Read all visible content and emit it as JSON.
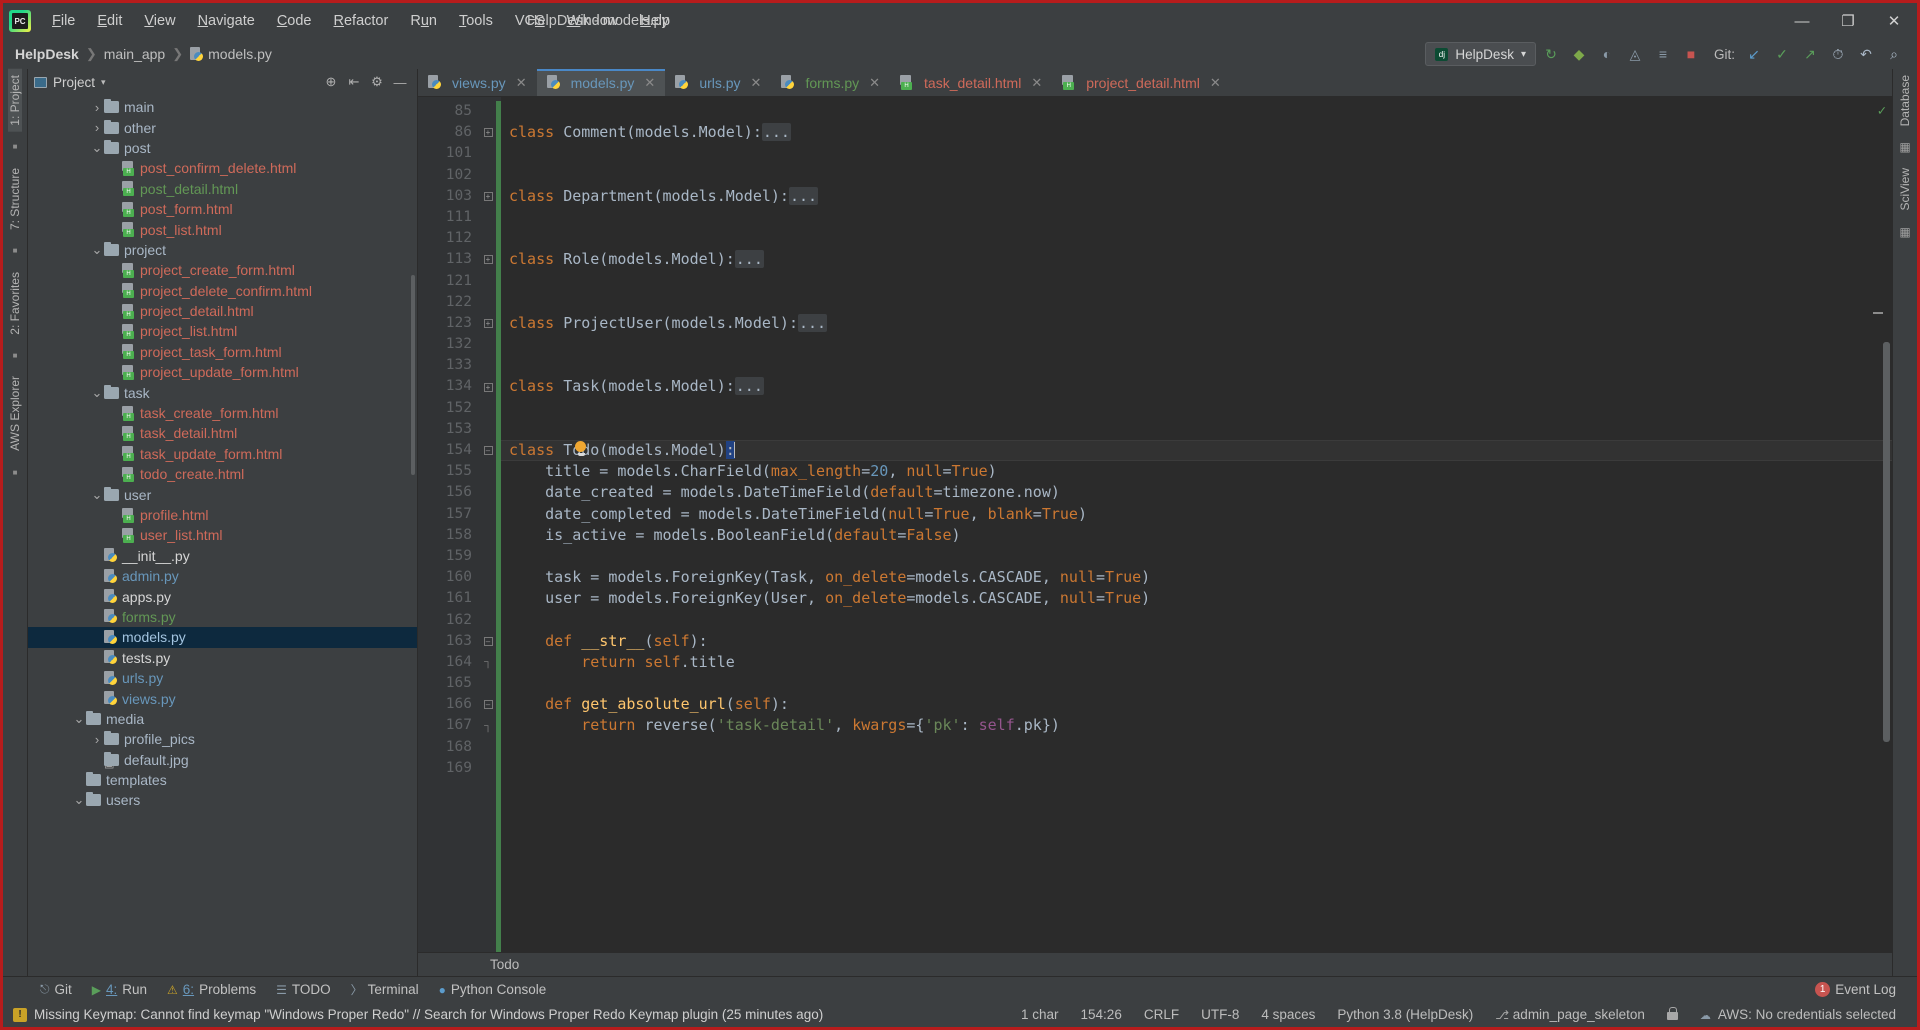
{
  "app": {
    "logo": "pycharm-logo",
    "window_title": "HelpDesk - models.py"
  },
  "menubar": {
    "items": [
      {
        "label": "File",
        "mn": "F"
      },
      {
        "label": "Edit",
        "mn": "E"
      },
      {
        "label": "View",
        "mn": "V"
      },
      {
        "label": "Navigate",
        "mn": "N"
      },
      {
        "label": "Code",
        "mn": "C"
      },
      {
        "label": "Refactor",
        "mn": "R"
      },
      {
        "label": "Run",
        "mn": "u"
      },
      {
        "label": "Tools",
        "mn": "T"
      },
      {
        "label": "VCS",
        "mn": "S"
      },
      {
        "label": "Window",
        "mn": "W"
      },
      {
        "label": "Help",
        "mn": "H"
      }
    ]
  },
  "window_controls": {
    "minimize": "—",
    "maximize": "❐",
    "close": "✕"
  },
  "breadcrumb": {
    "project": "HelpDesk",
    "app": "main_app",
    "file": "models.py",
    "sep": "❯"
  },
  "navbar_right": {
    "run_config": "HelpDesk",
    "run_config_caret": "▾",
    "icons": [
      {
        "name": "build-icon",
        "glyph": "↻"
      },
      {
        "name": "debug-icon",
        "glyph": "ὁe"
      },
      {
        "name": "coverage-icon",
        "glyph": "◔"
      },
      {
        "name": "profile-icon",
        "glyph": "◴"
      },
      {
        "name": "run-with-console-icon",
        "glyph": "≡"
      },
      {
        "name": "stop-icon",
        "glyph": "■"
      }
    ],
    "git_label": "Git:",
    "git_icons": [
      {
        "name": "git-update-icon",
        "glyph": "↙"
      },
      {
        "name": "git-commit-icon",
        "glyph": "✓"
      },
      {
        "name": "git-push-icon",
        "glyph": "↗"
      },
      {
        "name": "git-history-icon",
        "glyph": "◴"
      },
      {
        "name": "git-rollback-icon",
        "glyph": "↶"
      }
    ],
    "search_icon": "⌕"
  },
  "left_rail": {
    "items": [
      {
        "label": "1: Project",
        "active": true
      },
      {
        "label": "7: Structure",
        "active": false
      },
      {
        "label": "2: Favorites",
        "active": false
      },
      {
        "label": "AWS Explorer",
        "active": false
      }
    ],
    "bottom_icon": "aws-icon"
  },
  "right_rail": {
    "items": [
      {
        "label": "Database",
        "active": false
      },
      {
        "label": "SciView",
        "active": false
      }
    ]
  },
  "project_panel": {
    "title": "Project",
    "title_caret": "▾",
    "header_icons": [
      {
        "name": "target-icon",
        "glyph": "⊕"
      },
      {
        "name": "collapse-all-icon",
        "glyph": "⇥"
      },
      {
        "name": "settings-gear-icon",
        "glyph": "⚙"
      },
      {
        "name": "hide-panel-icon",
        "glyph": "—"
      }
    ],
    "tree": [
      {
        "label": "main",
        "type": "folder",
        "indent": 2,
        "arrow": "›",
        "color": "#a9b7c6"
      },
      {
        "label": "other",
        "type": "folder",
        "indent": 2,
        "arrow": "›",
        "color": "#a9b7c6"
      },
      {
        "label": "post",
        "type": "folder",
        "indent": 2,
        "arrow": "⌄",
        "color": "#a9b7c6"
      },
      {
        "label": "post_confirm_delete.html",
        "type": "html",
        "indent": 3,
        "color": "#cf6a5a"
      },
      {
        "label": "post_detail.html",
        "type": "html",
        "indent": 3,
        "color": "#629755"
      },
      {
        "label": "post_form.html",
        "type": "html",
        "indent": 3,
        "color": "#cf6a5a"
      },
      {
        "label": "post_list.html",
        "type": "html",
        "indent": 3,
        "color": "#cf6a5a"
      },
      {
        "label": "project",
        "type": "folder",
        "indent": 2,
        "arrow": "⌄",
        "color": "#a9b7c6"
      },
      {
        "label": "project_create_form.html",
        "type": "html",
        "indent": 3,
        "color": "#cf6a5a"
      },
      {
        "label": "project_delete_confirm.html",
        "type": "html",
        "indent": 3,
        "color": "#cf6a5a"
      },
      {
        "label": "project_detail.html",
        "type": "html",
        "indent": 3,
        "color": "#cf6a5a"
      },
      {
        "label": "project_list.html",
        "type": "html",
        "indent": 3,
        "color": "#cf6a5a"
      },
      {
        "label": "project_task_form.html",
        "type": "html",
        "indent": 3,
        "color": "#cf6a5a"
      },
      {
        "label": "project_update_form.html",
        "type": "html",
        "indent": 3,
        "color": "#cf6a5a"
      },
      {
        "label": "task",
        "type": "folder",
        "indent": 2,
        "arrow": "⌄",
        "color": "#a9b7c6"
      },
      {
        "label": "task_create_form.html",
        "type": "html",
        "indent": 3,
        "color": "#cf6a5a"
      },
      {
        "label": "task_detail.html",
        "type": "html",
        "indent": 3,
        "color": "#cf6a5a"
      },
      {
        "label": "task_update_form.html",
        "type": "html",
        "indent": 3,
        "color": "#cf6a5a"
      },
      {
        "label": "todo_create.html",
        "type": "html",
        "indent": 3,
        "color": "#cf6a5a"
      },
      {
        "label": "user",
        "type": "folder",
        "indent": 2,
        "arrow": "⌄",
        "color": "#a9b7c6"
      },
      {
        "label": "profile.html",
        "type": "html",
        "indent": 3,
        "color": "#cf6a5a"
      },
      {
        "label": "user_list.html",
        "type": "html",
        "indent": 3,
        "color": "#cf6a5a"
      },
      {
        "label": "__init__.py",
        "type": "py",
        "indent": 2,
        "color": "#d6d6d6"
      },
      {
        "label": "admin.py",
        "type": "py",
        "indent": 2,
        "color": "#6897bb"
      },
      {
        "label": "apps.py",
        "type": "py",
        "indent": 2,
        "color": "#d6d6d6"
      },
      {
        "label": "forms.py",
        "type": "py",
        "indent": 2,
        "color": "#629755"
      },
      {
        "label": "models.py",
        "type": "py",
        "indent": 2,
        "color": "#a3c4e0",
        "selected": true
      },
      {
        "label": "tests.py",
        "type": "py",
        "indent": 2,
        "color": "#d6d6d6"
      },
      {
        "label": "urls.py",
        "type": "py",
        "indent": 2,
        "color": "#6897bb"
      },
      {
        "label": "views.py",
        "type": "py",
        "indent": 2,
        "color": "#6897bb"
      },
      {
        "label": "media",
        "type": "folder",
        "indent": 1,
        "arrow": "⌄",
        "color": "#a9b7c6"
      },
      {
        "label": "profile_pics",
        "type": "folder",
        "indent": 2,
        "arrow": "›",
        "color": "#a9b7c6"
      },
      {
        "label": "default.jpg",
        "type": "img",
        "indent": 2,
        "color": "#a9b7c6"
      },
      {
        "label": "templates",
        "type": "folder",
        "indent": 1,
        "arrow": "",
        "color": "#a9b7c6"
      },
      {
        "label": "users",
        "type": "folder",
        "indent": 1,
        "arrow": "⌄",
        "color": "#a9b7c6"
      }
    ]
  },
  "editor_tabs": [
    {
      "label": "views.py",
      "type": "py",
      "color": "#6897bb",
      "active": false,
      "close": "✕"
    },
    {
      "label": "models.py",
      "type": "py",
      "color": "#6897bb",
      "active": true,
      "close": "✕"
    },
    {
      "label": "urls.py",
      "type": "py",
      "color": "#6897bb",
      "active": false,
      "close": "✕"
    },
    {
      "label": "forms.py",
      "type": "py",
      "color": "#629755",
      "active": false,
      "close": "✕"
    },
    {
      "label": "task_detail.html",
      "type": "html",
      "color": "#cf6a5a",
      "active": false,
      "close": "✕"
    },
    {
      "label": "project_detail.html",
      "type": "html",
      "color": "#cf6a5a",
      "active": false,
      "close": "✕"
    }
  ],
  "editor": {
    "line_numbers": [
      "85",
      "86",
      "101",
      "102",
      "103",
      "111",
      "112",
      "113",
      "121",
      "122",
      "123",
      "132",
      "133",
      "134",
      "152",
      "153",
      "154",
      "155",
      "156",
      "157",
      "158",
      "159",
      "160",
      "161",
      "162",
      "163",
      "164",
      "165",
      "166",
      "167",
      "168",
      "169"
    ],
    "status_breadcrumb": "Todo",
    "caret_position": "154:26",
    "lightbulb": "intention-bulb-icon",
    "inspection_ok": "✓"
  },
  "code_lines": [
    {
      "num": "85",
      "fold": "",
      "segs": []
    },
    {
      "num": "86",
      "fold": "+",
      "segs": [
        {
          "t": "class ",
          "c": "kw"
        },
        {
          "t": "Comment(models.Model):",
          "c": "cls"
        },
        {
          "t": "...",
          "c": "fold3"
        }
      ]
    },
    {
      "num": "101",
      "fold": "",
      "segs": []
    },
    {
      "num": "102",
      "fold": "",
      "segs": []
    },
    {
      "num": "103",
      "fold": "+",
      "segs": [
        {
          "t": "class ",
          "c": "kw"
        },
        {
          "t": "Department(models.Model):",
          "c": "cls"
        },
        {
          "t": "...",
          "c": "fold3"
        }
      ]
    },
    {
      "num": "111",
      "fold": "",
      "segs": []
    },
    {
      "num": "112",
      "fold": "",
      "segs": []
    },
    {
      "num": "113",
      "fold": "+",
      "segs": [
        {
          "t": "class ",
          "c": "kw"
        },
        {
          "t": "Role(models.Model):",
          "c": "cls"
        },
        {
          "t": "...",
          "c": "fold3"
        }
      ]
    },
    {
      "num": "121",
      "fold": "",
      "segs": []
    },
    {
      "num": "122",
      "fold": "",
      "segs": []
    },
    {
      "num": "123",
      "fold": "+",
      "segs": [
        {
          "t": "class ",
          "c": "kw"
        },
        {
          "t": "ProjectUser(models.Model):",
          "c": "cls"
        },
        {
          "t": "...",
          "c": "fold3"
        }
      ]
    },
    {
      "num": "132",
      "fold": "",
      "segs": []
    },
    {
      "num": "133",
      "fold": "",
      "segs": []
    },
    {
      "num": "134",
      "fold": "+",
      "segs": [
        {
          "t": "class ",
          "c": "kw"
        },
        {
          "t": "Task(models.Model):",
          "c": "cls"
        },
        {
          "t": "...",
          "c": "fold3"
        }
      ]
    },
    {
      "num": "152",
      "fold": "",
      "segs": []
    },
    {
      "num": "153",
      "fold": "",
      "segs": []
    },
    {
      "num": "154",
      "fold": "-",
      "cur": true,
      "segs": [
        {
          "t": "class ",
          "c": "kw"
        },
        {
          "t": "Todo(models.Model)",
          "c": "cls"
        },
        {
          "t": ":",
          "c": "selchar"
        },
        {
          "t": "|caret|",
          "c": "caret"
        }
      ]
    },
    {
      "num": "155",
      "fold": "",
      "segs": [
        {
          "t": "    title = models.CharField(",
          "c": "id"
        },
        {
          "t": "max_length",
          "c": "param"
        },
        {
          "t": "=",
          "c": "punct"
        },
        {
          "t": "20",
          "c": "num"
        },
        {
          "t": ", ",
          "c": "punct"
        },
        {
          "t": "null",
          "c": "param"
        },
        {
          "t": "=",
          "c": "punct"
        },
        {
          "t": "True",
          "c": "param"
        },
        {
          "t": ")",
          "c": "punct"
        }
      ]
    },
    {
      "num": "156",
      "fold": "",
      "segs": [
        {
          "t": "    date_created = models.DateTimeField(",
          "c": "id"
        },
        {
          "t": "default",
          "c": "param"
        },
        {
          "t": "=",
          "c": "punct"
        },
        {
          "t": "timezone.now",
          "c": "id"
        },
        {
          "t": ")",
          "c": "punct"
        }
      ]
    },
    {
      "num": "157",
      "fold": "",
      "segs": [
        {
          "t": "    date_completed = models.DateTimeField(",
          "c": "id"
        },
        {
          "t": "null",
          "c": "param"
        },
        {
          "t": "=",
          "c": "punct"
        },
        {
          "t": "True",
          "c": "param"
        },
        {
          "t": ", ",
          "c": "punct"
        },
        {
          "t": "blank",
          "c": "param"
        },
        {
          "t": "=",
          "c": "punct"
        },
        {
          "t": "True",
          "c": "param"
        },
        {
          "t": ")",
          "c": "punct"
        }
      ]
    },
    {
      "num": "158",
      "fold": "",
      "segs": [
        {
          "t": "    is_active = models.BooleanField(",
          "c": "id"
        },
        {
          "t": "default",
          "c": "param"
        },
        {
          "t": "=",
          "c": "punct"
        },
        {
          "t": "False",
          "c": "param"
        },
        {
          "t": ")",
          "c": "punct"
        }
      ]
    },
    {
      "num": "159",
      "fold": "",
      "segs": []
    },
    {
      "num": "160",
      "fold": "",
      "segs": [
        {
          "t": "    task = models.ForeignKey(Task, ",
          "c": "id"
        },
        {
          "t": "on_delete",
          "c": "param"
        },
        {
          "t": "=",
          "c": "punct"
        },
        {
          "t": "models.CASCADE",
          "c": "id"
        },
        {
          "t": ", ",
          "c": "punct"
        },
        {
          "t": "null",
          "c": "param"
        },
        {
          "t": "=",
          "c": "punct"
        },
        {
          "t": "True",
          "c": "param"
        },
        {
          "t": ")",
          "c": "punct"
        }
      ]
    },
    {
      "num": "161",
      "fold": "",
      "segs": [
        {
          "t": "    user = models.ForeignKey(User, ",
          "c": "id"
        },
        {
          "t": "on_delete",
          "c": "param"
        },
        {
          "t": "=",
          "c": "punct"
        },
        {
          "t": "models.CASCADE",
          "c": "id"
        },
        {
          "t": ", ",
          "c": "punct"
        },
        {
          "t": "null",
          "c": "param"
        },
        {
          "t": "=",
          "c": "punct"
        },
        {
          "t": "True",
          "c": "param"
        },
        {
          "t": ")",
          "c": "punct"
        }
      ]
    },
    {
      "num": "162",
      "fold": "",
      "segs": []
    },
    {
      "num": "163",
      "fold": "-",
      "segs": [
        {
          "t": "    ",
          "c": "id"
        },
        {
          "t": "def ",
          "c": "kw"
        },
        {
          "t": "__str__",
          "c": "fn"
        },
        {
          "t": "(",
          "c": "punct"
        },
        {
          "t": "self",
          "c": "param"
        },
        {
          "t": "):",
          "c": "punct"
        }
      ]
    },
    {
      "num": "164",
      "fold": "v",
      "segs": [
        {
          "t": "        ",
          "c": "id"
        },
        {
          "t": "return ",
          "c": "kw"
        },
        {
          "t": "self",
          "c": "param"
        },
        {
          "t": ".title",
          "c": "id"
        }
      ]
    },
    {
      "num": "165",
      "fold": "",
      "segs": []
    },
    {
      "num": "166",
      "fold": "-",
      "segs": [
        {
          "t": "    ",
          "c": "id"
        },
        {
          "t": "def ",
          "c": "kw"
        },
        {
          "t": "get_absolute_url",
          "c": "fn"
        },
        {
          "t": "(",
          "c": "punct"
        },
        {
          "t": "self",
          "c": "param"
        },
        {
          "t": "):",
          "c": "punct"
        }
      ]
    },
    {
      "num": "167",
      "fold": "v",
      "segs": [
        {
          "t": "        ",
          "c": "id"
        },
        {
          "t": "return ",
          "c": "kw"
        },
        {
          "t": "reverse(",
          "c": "id"
        },
        {
          "t": "'task-detail'",
          "c": "str"
        },
        {
          "t": ", ",
          "c": "punct"
        },
        {
          "t": "kwargs",
          "c": "param"
        },
        {
          "t": "={",
          "c": "punct"
        },
        {
          "t": "'pk'",
          "c": "str"
        },
        {
          "t": ": ",
          "c": "punct"
        },
        {
          "t": "self",
          "c": "self"
        },
        {
          "t": ".pk})",
          "c": "id"
        }
      ]
    },
    {
      "num": "168",
      "fold": "",
      "segs": []
    },
    {
      "num": "169",
      "fold": "",
      "segs": []
    }
  ],
  "tool_windows": {
    "left": [
      {
        "num": "",
        "label": "Git",
        "icon": "git-icon"
      },
      {
        "num": "4:",
        "label": "Run",
        "icon": "run-icon"
      },
      {
        "num": "6:",
        "label": "Problems",
        "icon": "problems-icon"
      },
      {
        "num": "",
        "label": "TODO",
        "icon": "todo-icon"
      },
      {
        "num": "",
        "label": "Terminal",
        "icon": "terminal-icon"
      },
      {
        "num": "",
        "label": "Python Console",
        "icon": "python-console-icon"
      }
    ],
    "event_log": {
      "count": "1",
      "label": "Event Log"
    }
  },
  "statusbar": {
    "warning": "Missing Keymap: Cannot find keymap \"Windows Proper Redo\" // Search for Windows Proper Redo Keymap plugin (25 minutes ago)",
    "warning_icon": "warning-icon",
    "items": [
      {
        "name": "char-count",
        "label": "1 char"
      },
      {
        "name": "caret-position",
        "label": "154:26"
      },
      {
        "name": "line-separator",
        "label": "CRLF"
      },
      {
        "name": "file-encoding",
        "label": "UTF-8"
      },
      {
        "name": "indent",
        "label": "4 spaces"
      },
      {
        "name": "python-interpreter",
        "label": "Python 3.8 (HelpDesk)"
      }
    ],
    "branch": "admin_page_skeleton",
    "branch_icon": "git-branch-icon",
    "lock_icon": "lock-icon",
    "aws": "AWS: No credentials selected",
    "aws_icon": "aws-icon"
  },
  "colors": {
    "bg_chrome": "#3c3f41",
    "bg_editor": "#2b2b2b",
    "bg_gutter": "#313335",
    "accent_selection": "#0d293e",
    "keyword": "#cc7832",
    "string": "#6a8759",
    "number": "#6897bb",
    "function": "#ffc66d",
    "border_red": "#b71c1c"
  }
}
